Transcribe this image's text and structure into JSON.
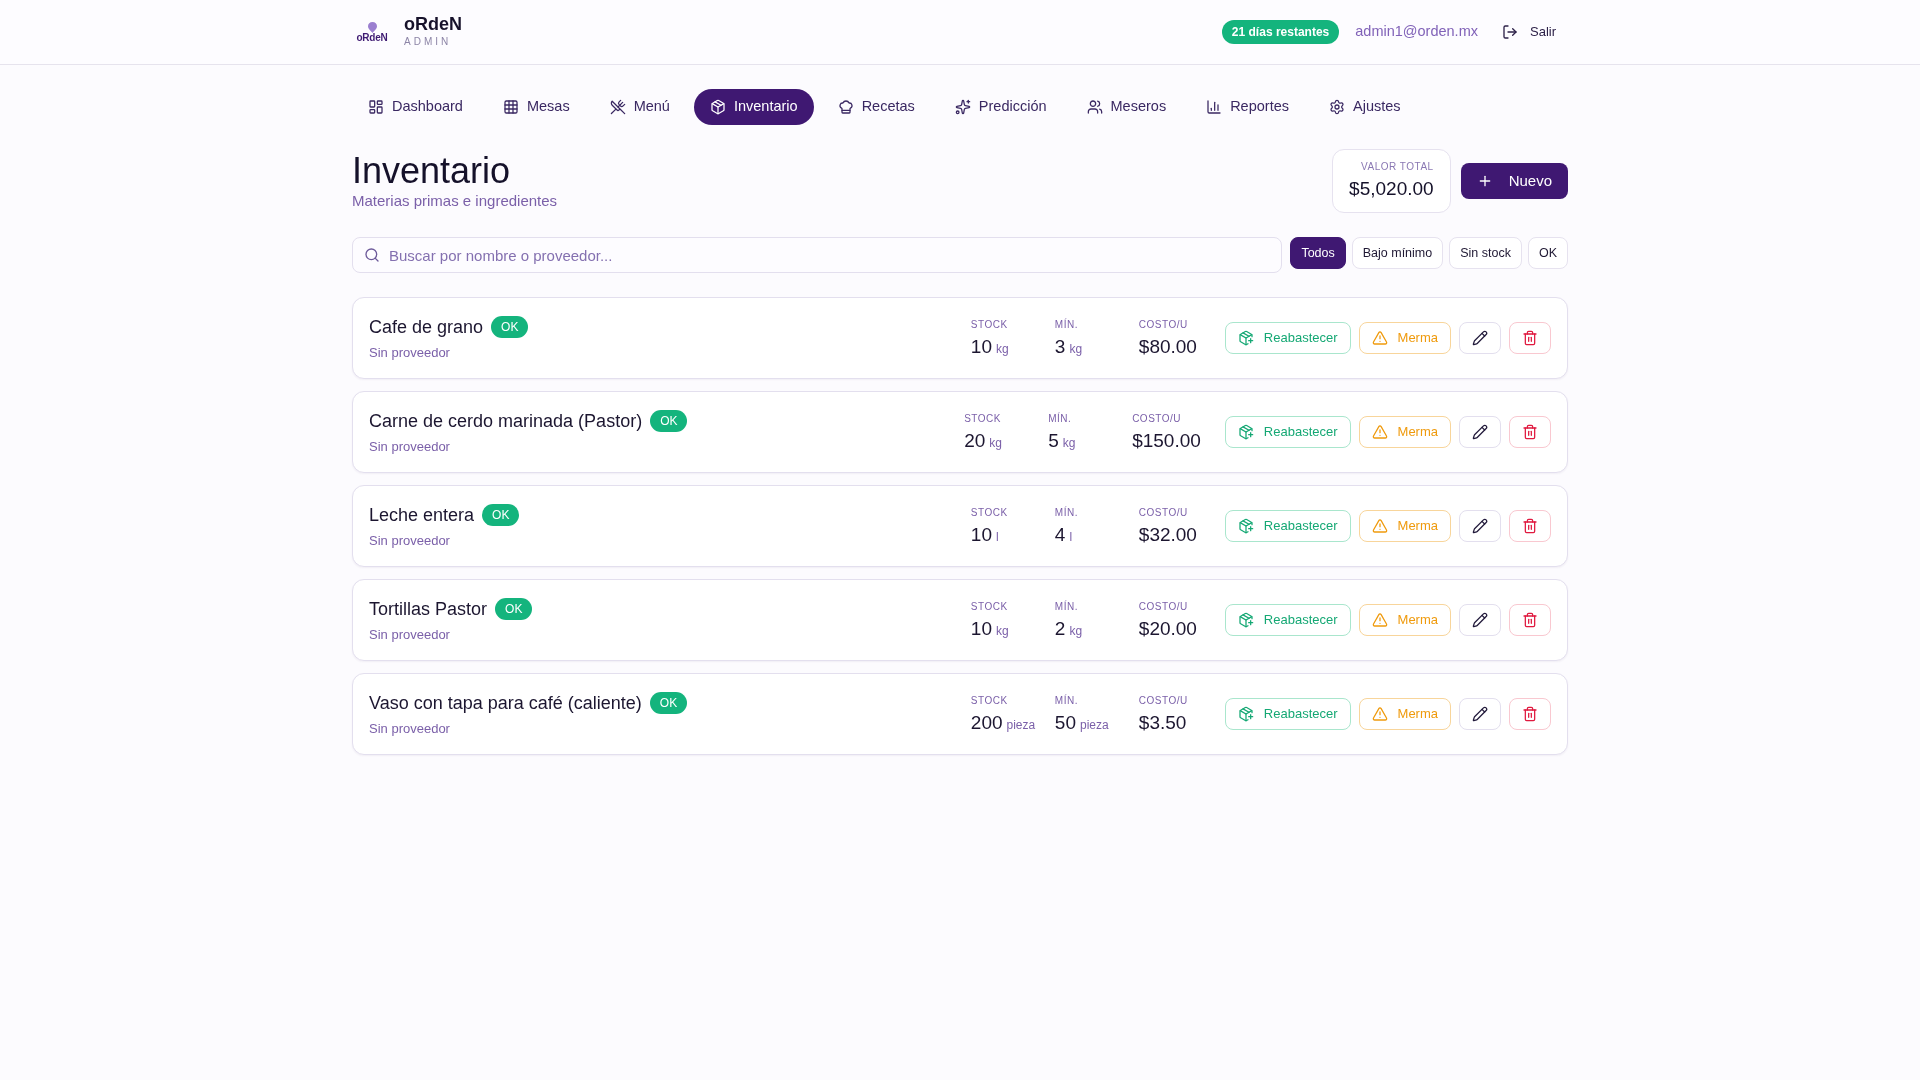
{
  "header": {
    "logo_text": "oRdeN",
    "brand": "oRdeN",
    "brand_sub": "ADMIN",
    "trial_badge": "21 días restantes",
    "user_email": "admin1@orden.mx",
    "logout": "Salir"
  },
  "nav": [
    {
      "label": "Dashboard",
      "selected": false
    },
    {
      "label": "Mesas",
      "selected": false
    },
    {
      "label": "Menú",
      "selected": false
    },
    {
      "label": "Inventario",
      "selected": true
    },
    {
      "label": "Recetas",
      "selected": false
    },
    {
      "label": "Predicción",
      "selected": false
    },
    {
      "label": "Meseros",
      "selected": false
    },
    {
      "label": "Reportes",
      "selected": false
    },
    {
      "label": "Ajustes",
      "selected": false
    }
  ],
  "page": {
    "title": "Inventario",
    "subtitle": "Materias primas e ingredientes",
    "total": {
      "label": "VALOR TOTAL",
      "value": "$5,020.00"
    },
    "new_button": "Nuevo"
  },
  "search": {
    "placeholder": "Buscar por nombre o proveedor..."
  },
  "filters": [
    {
      "label": "Todos",
      "selected": true
    },
    {
      "label": "Bajo mínimo",
      "selected": false
    },
    {
      "label": "Sin stock",
      "selected": false
    },
    {
      "label": "OK",
      "selected": false
    }
  ],
  "items": [
    {
      "name": "Cafe de grano",
      "status": "OK",
      "supplier": "Sin proveedor",
      "stats": [
        {
          "label": "STOCK",
          "value": "10",
          "unit": "kg"
        },
        {
          "label": "MÍN.",
          "value": "3",
          "unit": "kg"
        },
        {
          "label": "COSTO/U",
          "value": "$80.00"
        }
      ],
      "restock": "Reabastecer",
      "waste": "Merma"
    },
    {
      "name": "Carne de cerdo marinada (Pastor)",
      "status": "OK",
      "supplier": "Sin proveedor",
      "stats": [
        {
          "label": "STOCK",
          "value": "20",
          "unit": "kg"
        },
        {
          "label": "MÍN.",
          "value": "5",
          "unit": "kg"
        },
        {
          "label": "COSTO/U",
          "value": "$150.00"
        }
      ],
      "restock": "Reabastecer",
      "waste": "Merma"
    },
    {
      "name": "Leche entera",
      "status": "OK",
      "supplier": "Sin proveedor",
      "stats": [
        {
          "label": "STOCK",
          "value": "10",
          "unit": "l"
        },
        {
          "label": "MÍN.",
          "value": "4",
          "unit": "l"
        },
        {
          "label": "COSTO/U",
          "value": "$32.00"
        }
      ],
      "restock": "Reabastecer",
      "waste": "Merma"
    },
    {
      "name": "Tortillas Pastor",
      "status": "OK",
      "supplier": "Sin proveedor",
      "stats": [
        {
          "label": "STOCK",
          "value": "10",
          "unit": "kg"
        },
        {
          "label": "MÍN.",
          "value": "2",
          "unit": "kg"
        },
        {
          "label": "COSTO/U",
          "value": "$20.00"
        }
      ],
      "restock": "Reabastecer",
      "waste": "Merma"
    },
    {
      "name": "Vaso con tapa para café (caliente)",
      "status": "OK",
      "supplier": "Sin proveedor",
      "stats": [
        {
          "label": "STOCK",
          "value": "200",
          "unit": "pieza"
        },
        {
          "label": "MÍN.",
          "value": "50",
          "unit": "pieza"
        },
        {
          "label": "COSTO/U",
          "value": "$3.50"
        }
      ],
      "restock": "Reabastecer",
      "waste": "Merma"
    }
  ]
}
